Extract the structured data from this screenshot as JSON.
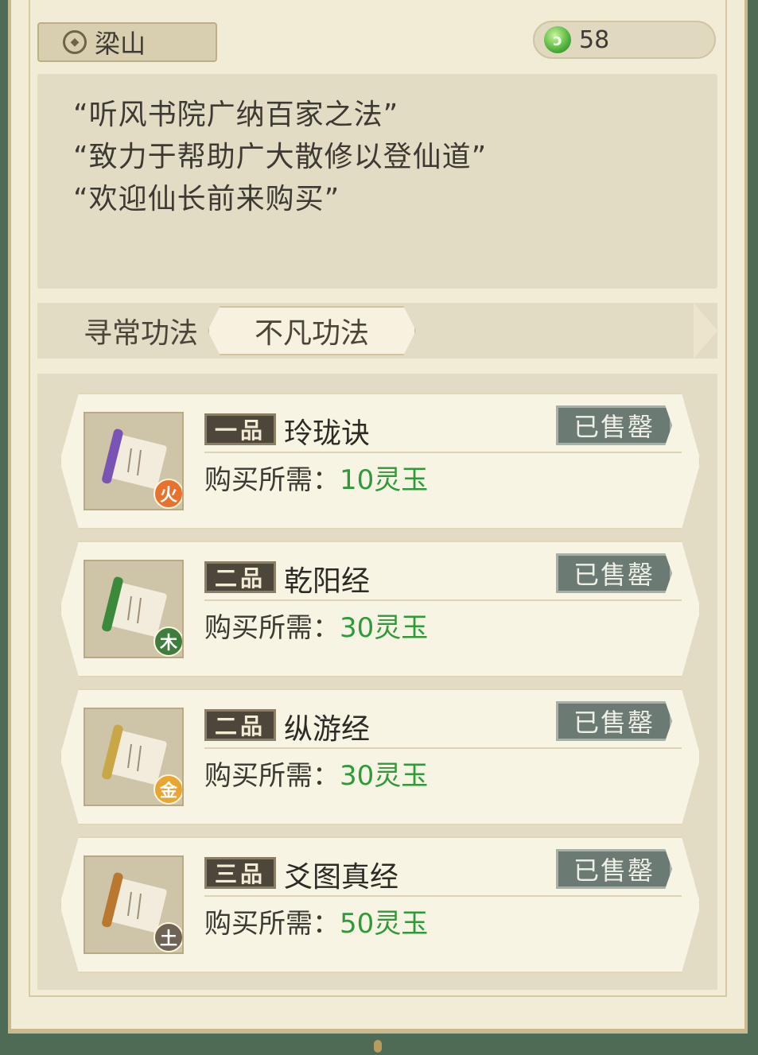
{
  "header": {
    "location": "梁山",
    "currency_value": "58",
    "currency_icon": "jade-icon"
  },
  "intro": {
    "lines": [
      "“听风书院广纳百家之法”",
      "“致力于帮助广大散修以登仙道”",
      "“欢迎仙长前来购买”"
    ]
  },
  "tabs": [
    {
      "label": "寻常功法",
      "active": false
    },
    {
      "label": "不凡功法",
      "active": true
    }
  ],
  "items": [
    {
      "grade": "一品",
      "name": "玲珑诀",
      "price_label": "购买所需：",
      "price": "10灵玉",
      "status": "已售罄",
      "element": "火",
      "element_color": "#e8712d",
      "scroll_color": "#7a54b5"
    },
    {
      "grade": "二品",
      "name": "乾阳经",
      "price_label": "购买所需：",
      "price": "30灵玉",
      "status": "已售罄",
      "element": "木",
      "element_color": "#3f7d3f",
      "scroll_color": "#3b8a3b"
    },
    {
      "grade": "二品",
      "name": "纵游经",
      "price_label": "购买所需：",
      "price": "30灵玉",
      "status": "已售罄",
      "element": "金",
      "element_color": "#e8a534",
      "scroll_color": "#c9a646"
    },
    {
      "grade": "三品",
      "name": "爻图真经",
      "price_label": "购买所需：",
      "price": "50灵玉",
      "status": "已售罄",
      "element": "土",
      "element_color": "#6e6355",
      "scroll_color": "#b9782f"
    }
  ]
}
